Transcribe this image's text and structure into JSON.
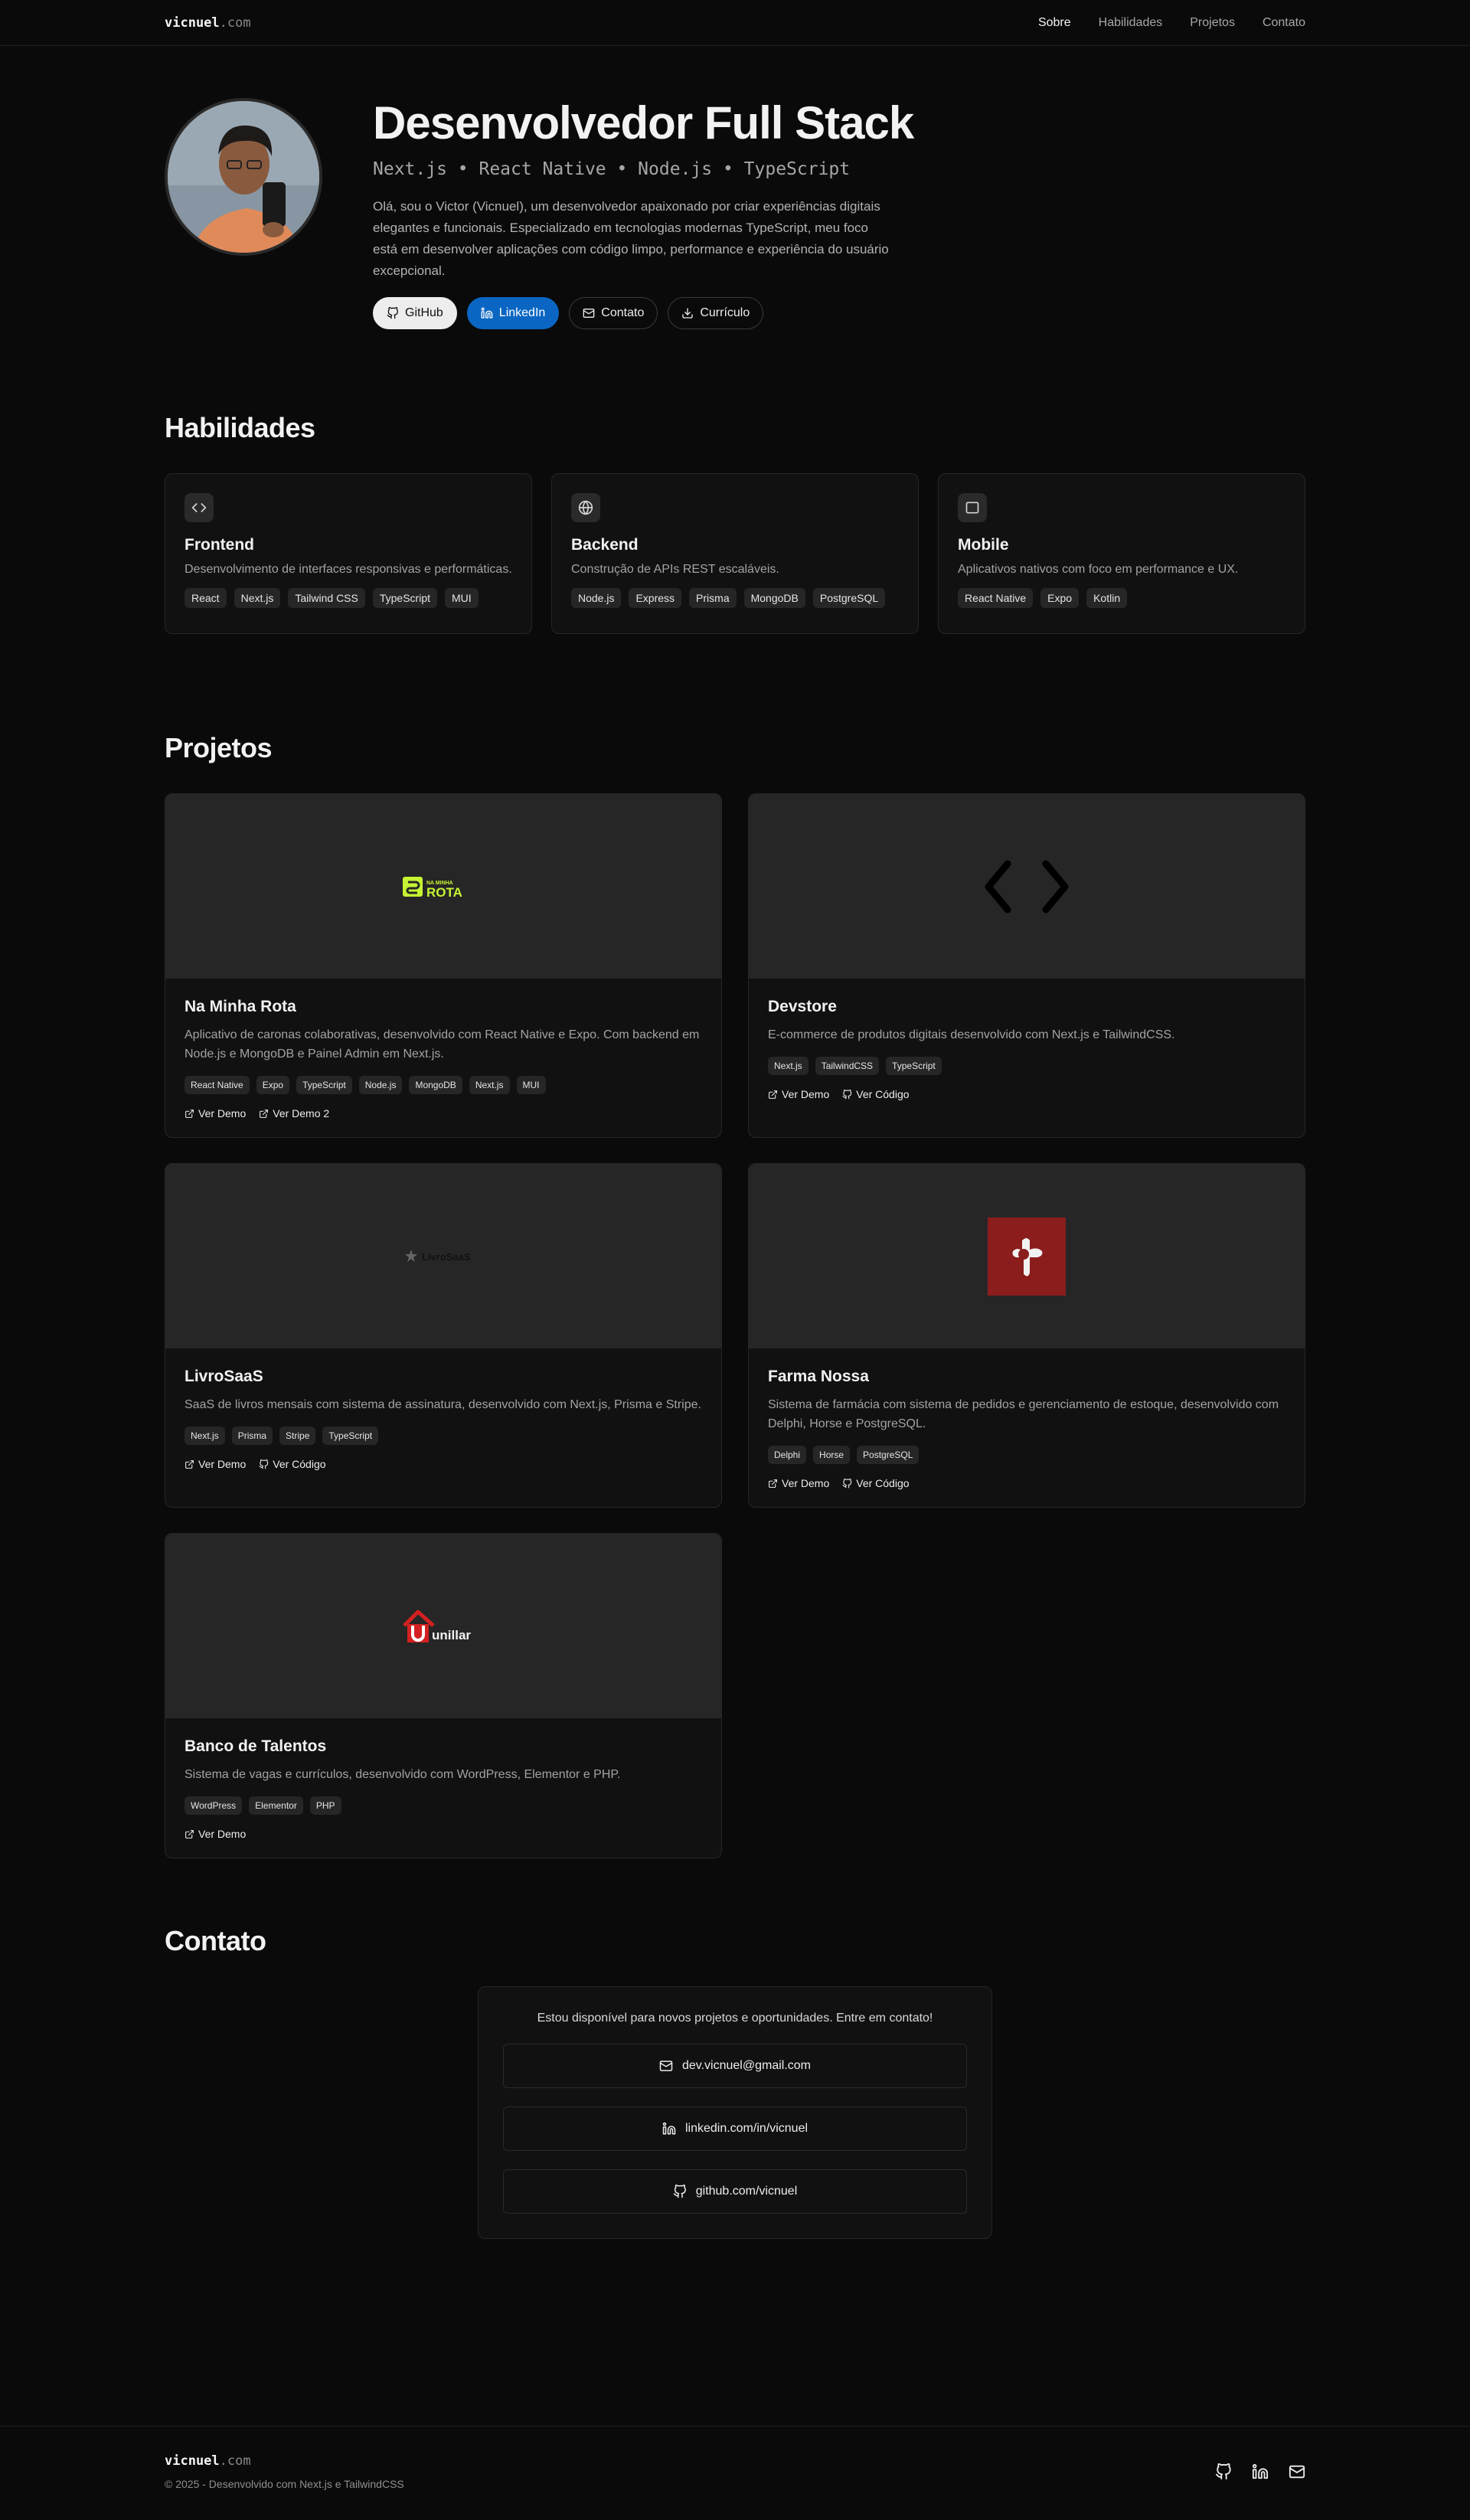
{
  "nav": {
    "logo_name": "vicnuel",
    "logo_domain": ".com",
    "links": [
      "Sobre",
      "Habilidades",
      "Projetos",
      "Contato"
    ]
  },
  "hero": {
    "title": "Desenvolvedor Full Stack",
    "stack": "Next.js • React Native • Node.js • TypeScript",
    "bio": "Olá, sou o Victor (Vicnuel), um desenvolvedor apaixonado por criar experiências digitais elegantes e funcionais. Especializado em tecnologias modernas TypeScript, meu foco está em desenvolver aplicações com código limpo, performance e experiência do usuário excepcional.",
    "buttons": {
      "github": "GitHub",
      "linkedin": "LinkedIn",
      "contact": "Contato",
      "resume": "Currículo"
    },
    "linkedin_color": "#0a66c2"
  },
  "skills": {
    "title": "Habilidades",
    "cards": [
      {
        "icon": "code-icon",
        "title": "Frontend",
        "desc": "Desenvolvimento de interfaces responsivas e performáticas.",
        "tags": [
          "React",
          "Next.js",
          "Tailwind CSS",
          "TypeScript",
          "MUI"
        ]
      },
      {
        "icon": "globe-icon",
        "title": "Backend",
        "desc": "Construção de APIs REST escaláveis.",
        "tags": [
          "Node.js",
          "Express",
          "Prisma",
          "MongoDB",
          "PostgreSQL"
        ]
      },
      {
        "icon": "monitor-icon",
        "title": "Mobile",
        "desc": "Aplicativos nativos com foco em performance e UX.",
        "tags": [
          "React Native",
          "Expo",
          "Kotlin"
        ]
      }
    ]
  },
  "projects": {
    "title": "Projetos",
    "items": [
      {
        "title": "Na Minha Rota",
        "desc": "Aplicativo de caronas colaborativas, desenvolvido com React Native e Expo. Com backend em Node.js e MongoDB e Painel Admin em Next.js.",
        "tags": [
          "React Native",
          "Expo",
          "TypeScript",
          "Node.js",
          "MongoDB",
          "Next.js",
          "MUI"
        ],
        "links": [
          "Ver Demo",
          "Ver Demo 2"
        ],
        "logo_text_small": "NA MINHA",
        "logo_text_big": "ROTA"
      },
      {
        "title": "Devstore",
        "desc": "E-commerce de produtos digitais desenvolvido com Next.js e TailwindCSS.",
        "tags": [
          "Next.js",
          "TailwindCSS",
          "TypeScript"
        ],
        "links": [
          "Ver Demo",
          "Ver Código"
        ]
      },
      {
        "title": "LivroSaaS",
        "desc": "SaaS de livros mensais com sistema de assinatura, desenvolvido com Next.js, Prisma e Stripe.",
        "tags": [
          "Next.js",
          "Prisma",
          "Stripe",
          "TypeScript"
        ],
        "links": [
          "Ver Demo",
          "Ver Código"
        ],
        "logo_text": "LivroSaaS"
      },
      {
        "title": "Farma Nossa",
        "desc": "Sistema de farmácia com sistema de pedidos e gerenciamento de estoque, desenvolvido com Delphi, Horse e PostgreSQL.",
        "tags": [
          "Delphi",
          "Horse",
          "PostgreSQL"
        ],
        "links": [
          "Ver Demo",
          "Ver Código"
        ]
      },
      {
        "title": "Banco de Talentos",
        "desc": "Sistema de vagas e currículos, desenvolvido com WordPress, Elementor e PHP.",
        "tags": [
          "WordPress",
          "Elementor",
          "PHP"
        ],
        "links": [
          "Ver Demo"
        ],
        "logo_text": "unillar"
      }
    ]
  },
  "contact": {
    "title": "Contato",
    "intro": "Estou disponível para novos projetos e oportunidades. Entre em contato!",
    "email": "dev.vicnuel@gmail.com",
    "linkedin": "linkedin.com/in/vicnuel",
    "github": "github.com/vicnuel"
  },
  "footer": {
    "logo_name": "vicnuel",
    "logo_domain": ".com",
    "copyright": "© 2025 - Desenvolvido com Next.js e TailwindCSS"
  }
}
